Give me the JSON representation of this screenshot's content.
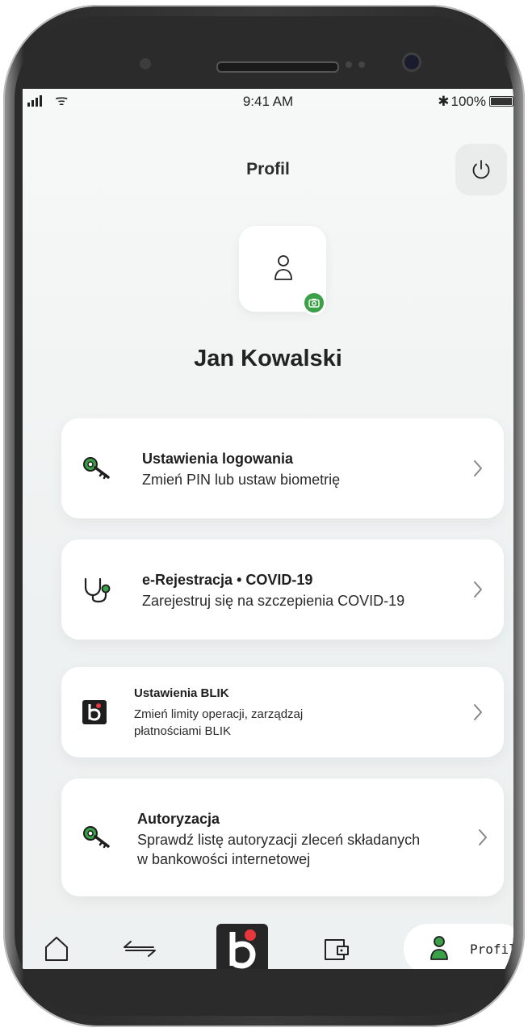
{
  "status_bar": {
    "time": "9:41 AM",
    "battery": "100%",
    "bluetooth_symbol": "✱",
    "wifi_symbol": "ᯤ"
  },
  "header": {
    "title": "Profil",
    "power_icon": "power-icon"
  },
  "profile": {
    "name": "Jan Kowalski",
    "avatar_icon": "person-icon",
    "badge_icon": "camera-icon",
    "badge_color": "#3ba047"
  },
  "menu": [
    {
      "title": "Ustawienia logowania",
      "subtitle": "Zmień PIN lub ustaw biometrię",
      "icon": "key-icon"
    },
    {
      "title": "e-Rejestracja • COVID-19",
      "subtitle": "Zarejestruj się na szczepienia COVID-19",
      "icon": "stethoscope-icon"
    },
    {
      "title": "Ustawienia BLIK",
      "subtitle_line1": "Zmień limity operacji, zarządzaj",
      "subtitle_line2": "płatnościami BLIK",
      "icon": "blik-icon"
    },
    {
      "title": "Autoryzacja",
      "subtitle_line1": "Sprawdź listę autoryzacji zleceń składanych",
      "subtitle_line2": "w bankowości internetowej",
      "icon": "key-icon"
    }
  ],
  "bottom_nav": {
    "active_label": "Profil",
    "items": [
      "home-icon",
      "transfer-icon",
      "blik-icon",
      "wallet-icon",
      "profile-icon"
    ]
  },
  "colors": {
    "accent_green": "#3ba047",
    "blik_red": "#e8363d",
    "dark": "#262626"
  }
}
